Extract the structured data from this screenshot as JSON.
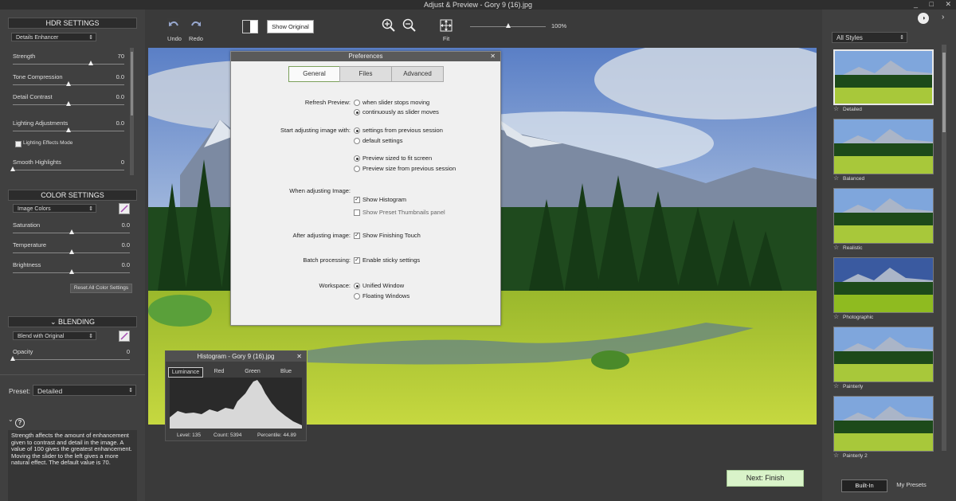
{
  "window": {
    "title": "Adjust & Preview - Gory 9 (16).jpg",
    "controls": [
      "_",
      "□",
      "✕"
    ]
  },
  "hdr": {
    "header": "HDR SETTINGS",
    "preset_dropdown": "Details Enhancer",
    "sliders": [
      {
        "label": "Strength",
        "value": "70",
        "level": 0.7
      },
      {
        "label": "Tone Compression",
        "value": "0.0",
        "level": 0.5
      },
      {
        "label": "Detail Contrast",
        "value": "0.0",
        "level": 0.5
      },
      {
        "label": "Lighting Adjustments",
        "value": "0.0",
        "level": 0.5
      },
      {
        "label": "Smooth Highlights",
        "value": "0",
        "level": 0.0
      }
    ],
    "lighting_mode_label": "Lighting Effects Mode"
  },
  "color": {
    "header": "COLOR SETTINGS",
    "dropdown": "Image Colors",
    "sliders": [
      {
        "label": "Saturation",
        "value": "0.0",
        "level": 0.5
      },
      {
        "label": "Temperature",
        "value": "0.0",
        "level": 0.5
      },
      {
        "label": "Brightness",
        "value": "0.0",
        "level": 0.5
      }
    ],
    "reset_label": "Reset All Color Settings"
  },
  "blending": {
    "header": "BLENDING",
    "dropdown": "Blend with Original",
    "slider": {
      "label": "Opacity",
      "value": "0",
      "level": 0.0
    }
  },
  "preset": {
    "label": "Preset:",
    "value": "Detailed"
  },
  "help": {
    "icon": "?",
    "text": "Strength affects the amount of enhancement given to contrast and detail in the image. A value of 100 gives the greatest enhancement. Moving the slider to the left gives a more natural effect. The default value is 70."
  },
  "toolbar": {
    "undo_label": "Undo",
    "redo_label": "Redo",
    "show_original_label": "Show Original",
    "fit_label": "Fit",
    "zoom_label": "100%"
  },
  "preferences": {
    "title": "Preferences",
    "tabs": [
      "General",
      "Files",
      "Advanced"
    ],
    "refresh_label": "Refresh Preview:",
    "refresh_opt1": "when slider stops moving",
    "refresh_opt2": "continuously as slider moves",
    "start_label": "Start adjusting image with:",
    "start_opt1": "settings from previous session",
    "start_opt2": "default settings",
    "size_opt1": "Preview sized to fit screen",
    "size_opt2": "Preview size from previous session",
    "when_label": "When adjusting Image:",
    "show_histogram": "Show Histogram",
    "show_preset_thumbs": "Show Preset Thumbnails panel",
    "after_label": "After adjusting image:",
    "show_finishing": "Show Finishing Touch",
    "batch_label": "Batch processing:",
    "sticky_settings": "Enable sticky settings",
    "workspace_label": "Workspace:",
    "ws_opt1": "Unified Window",
    "ws_opt2": "Floating Windows"
  },
  "histogram": {
    "title": "Histogram - Gory 9 (16).jpg",
    "tabs": [
      "Luminance",
      "Red",
      "Green",
      "Blue"
    ],
    "level": "Level: 135",
    "count": "Count: 5394",
    "percentile": "Percentile: 44.89"
  },
  "styles": {
    "dropdown": "All Styles",
    "items": [
      "Detailed",
      "Balanced",
      "Realistic",
      "Photographic",
      "Painterly",
      "Painterly 2"
    ],
    "tab_builtin": "Built-In",
    "tab_mypresets": "My Presets"
  },
  "next_button": "Next: Finish"
}
